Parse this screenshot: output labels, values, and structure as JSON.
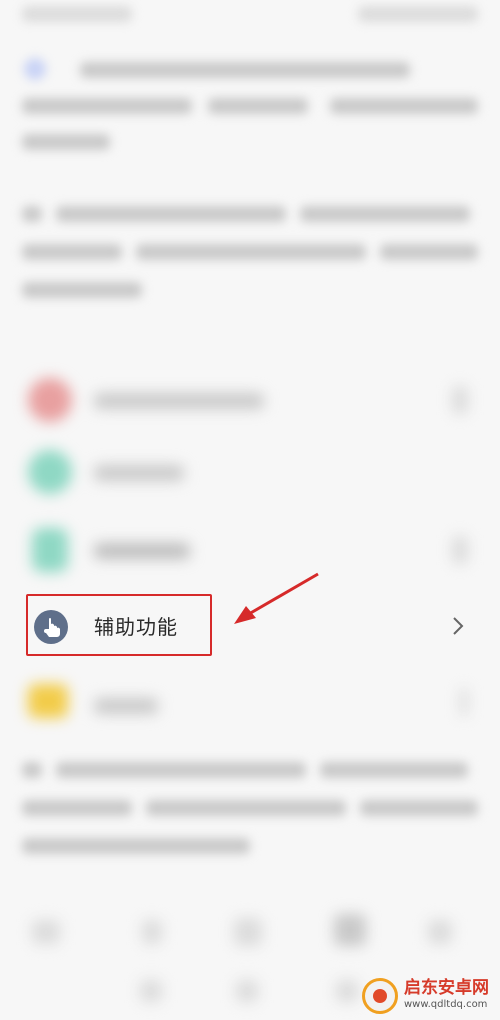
{
  "highlighted_item": {
    "label": "辅助功能",
    "icon": "hand-pointer-icon",
    "chevron": "chevron-right-icon"
  },
  "annotation": {
    "box_color": "#d62a2a",
    "arrow_color": "#d62a2a"
  },
  "blurred_items": {
    "icon_colors": [
      "#e8a0a0",
      "#8fd8c4",
      "#8fd8c4",
      "#f2cc4a"
    ]
  },
  "watermark": {
    "title": "启东安卓网",
    "url": "www.qdltdq.com"
  }
}
